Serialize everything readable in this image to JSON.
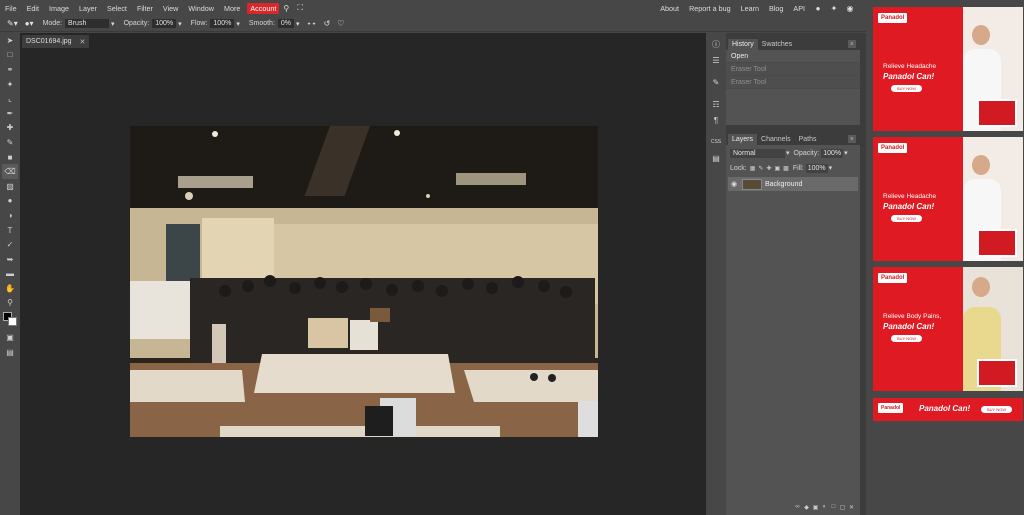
{
  "menu": {
    "items": [
      "File",
      "Edit",
      "Image",
      "Layer",
      "Select",
      "Filter",
      "View",
      "Window",
      "More"
    ],
    "account": "Account",
    "right_items": [
      "About",
      "Report a bug",
      "Learn",
      "Blog",
      "API"
    ]
  },
  "options": {
    "mode_label": "Mode:",
    "mode_value": "Brush",
    "opacity_label": "Opacity:",
    "opacity_value": "100%",
    "flow_label": "Flow:",
    "flow_value": "100%",
    "smooth_label": "Smooth:",
    "smooth_value": "0%"
  },
  "document": {
    "tab_name": "DSC01694.jpg",
    "close_glyph": "✕"
  },
  "history": {
    "tabs": [
      "History",
      "Swatches"
    ],
    "rows": [
      "Open",
      "Eraser Tool",
      "Eraser Tool"
    ]
  },
  "layers": {
    "tabs": [
      "Layers",
      "Channels",
      "Paths"
    ],
    "blend_mode": "Normal",
    "opacity_label": "Opacity:",
    "opacity_value": "100%",
    "lock_label": "Lock:",
    "fill_label": "Fill:",
    "fill_value": "100%",
    "layer_name": "Background"
  },
  "ads": [
    {
      "brand": "Panadol",
      "line1": "Relieve Headache",
      "line2": "Panadol Can!",
      "button": "BUY NOW"
    },
    {
      "brand": "Panadol",
      "line1": "Relieve Headache",
      "line2": "Panadol Can!",
      "button": "BUY NOW"
    },
    {
      "brand": "Panadol",
      "line1": "Relieve Body Pains,",
      "line2": "Panadol Can!",
      "button": "BUY NOW"
    },
    {
      "brand": "Panadol",
      "line1": "",
      "line2": "Panadol Can!",
      "button": "BUY NOW"
    }
  ],
  "colors": {
    "accent": "#d9272b",
    "panel_bg": "#535353",
    "app_bg": "#474747",
    "canvas_bg": "#262626",
    "foreground_swatch": "#000000",
    "background_swatch": "#ffffff"
  }
}
